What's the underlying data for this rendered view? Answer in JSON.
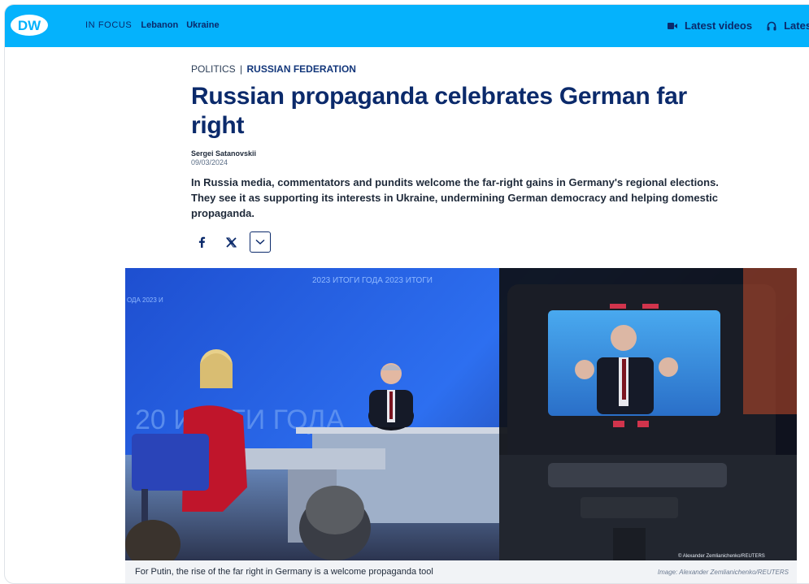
{
  "header": {
    "logo_text": "DW",
    "nav_focus_label": "IN FOCUS",
    "nav_links": [
      "Lebanon",
      "Ukraine"
    ],
    "right_links": [
      {
        "label": "Latest videos",
        "icon": "video-camera-icon"
      },
      {
        "label": "Latest audio",
        "icon": "headphones-icon"
      }
    ]
  },
  "article": {
    "kicker_category": "POLITICS",
    "kicker_separator": "|",
    "kicker_topic": "RUSSIAN FEDERATION",
    "headline": "Russian propaganda celebrates German far right",
    "author": "Sergei Satanovskii",
    "date": "09/03/2024",
    "teaser": "In Russia media, commentators and pundits welcome the far-right gains in Germany's regional elections. They see it as supporting its interests in Ukraine, undermining German democracy and helping domestic propaganda."
  },
  "share": {
    "icons": [
      "facebook-icon",
      "x-icon",
      "chevron-down-icon"
    ]
  },
  "image": {
    "backdrop_text_top": "2023 ИТОГИ ГОДА 2023 ИТОГИ",
    "backdrop_text_left": "ОДА 2023 И",
    "backdrop_text_main": "20  ИТОГИ ГОДА",
    "overlay_credit": "© Alexander Zemlianichenko/REUTERS",
    "caption": "For Putin, the rise of the far right in Germany is a welcome propaganda tool",
    "credit": "Image: Alexander Zemlianichenko/REUTERS"
  },
  "colors": {
    "brand_blue": "#05b2fc",
    "headline_navy": "#0b2a6b",
    "studio_blue": "#1c3fa8"
  }
}
